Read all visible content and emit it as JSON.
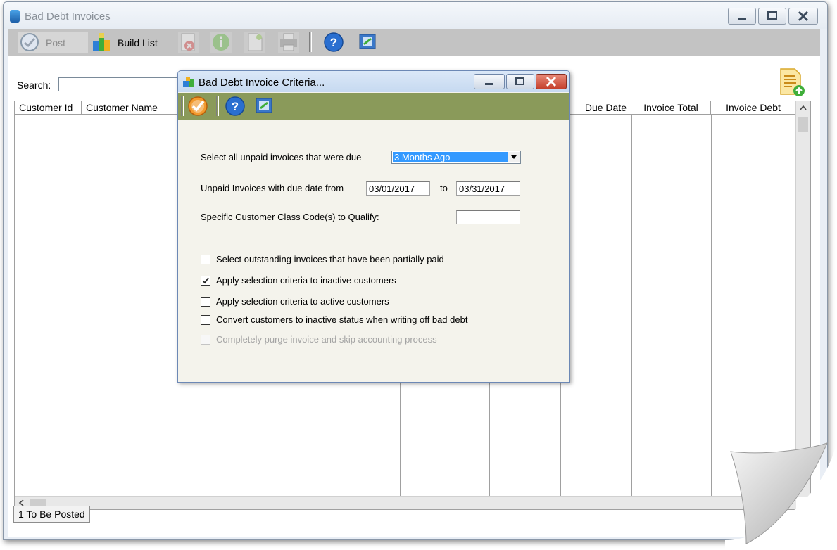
{
  "window": {
    "title": "Bad Debt Invoices",
    "toolbar": {
      "post_label": "Post",
      "build_list_label": "Build List"
    },
    "search": {
      "label": "Search:",
      "value": ""
    },
    "grid": {
      "columns": [
        "Customer Id",
        "Customer Name",
        "Due Date",
        "Invoice Total",
        "Invoice Debt"
      ]
    },
    "tab_label": "1 To Be Posted"
  },
  "dialog": {
    "title": "Bad Debt Invoice Criteria...",
    "due_label": "Select all unpaid invoices that were due",
    "due_selected": "3 Months Ago",
    "date_range_label": "Unpaid Invoices with due date from",
    "date_from": "03/01/2017",
    "to_label": "to",
    "date_to": "03/31/2017",
    "class_code_label": "Specific Customer Class Code(s) to Qualify:",
    "class_code_value": "",
    "checkboxes": [
      {
        "label": "Select outstanding invoices that have been partially paid",
        "checked": false,
        "enabled": true
      },
      {
        "label": "Apply selection criteria to inactive customers",
        "checked": true,
        "enabled": true
      },
      {
        "label": "Apply selection criteria to active customers",
        "checked": false,
        "enabled": true
      },
      {
        "label": "Convert customers to inactive status when writing off bad debt",
        "checked": false,
        "enabled": true
      },
      {
        "label": "Completely purge invoice and skip accounting process",
        "checked": false,
        "enabled": false
      }
    ]
  },
  "colors": {
    "dialog_toolbar": "#8a9a5a",
    "selection": "#3399ff",
    "toolbar": "#c3c3c3"
  }
}
